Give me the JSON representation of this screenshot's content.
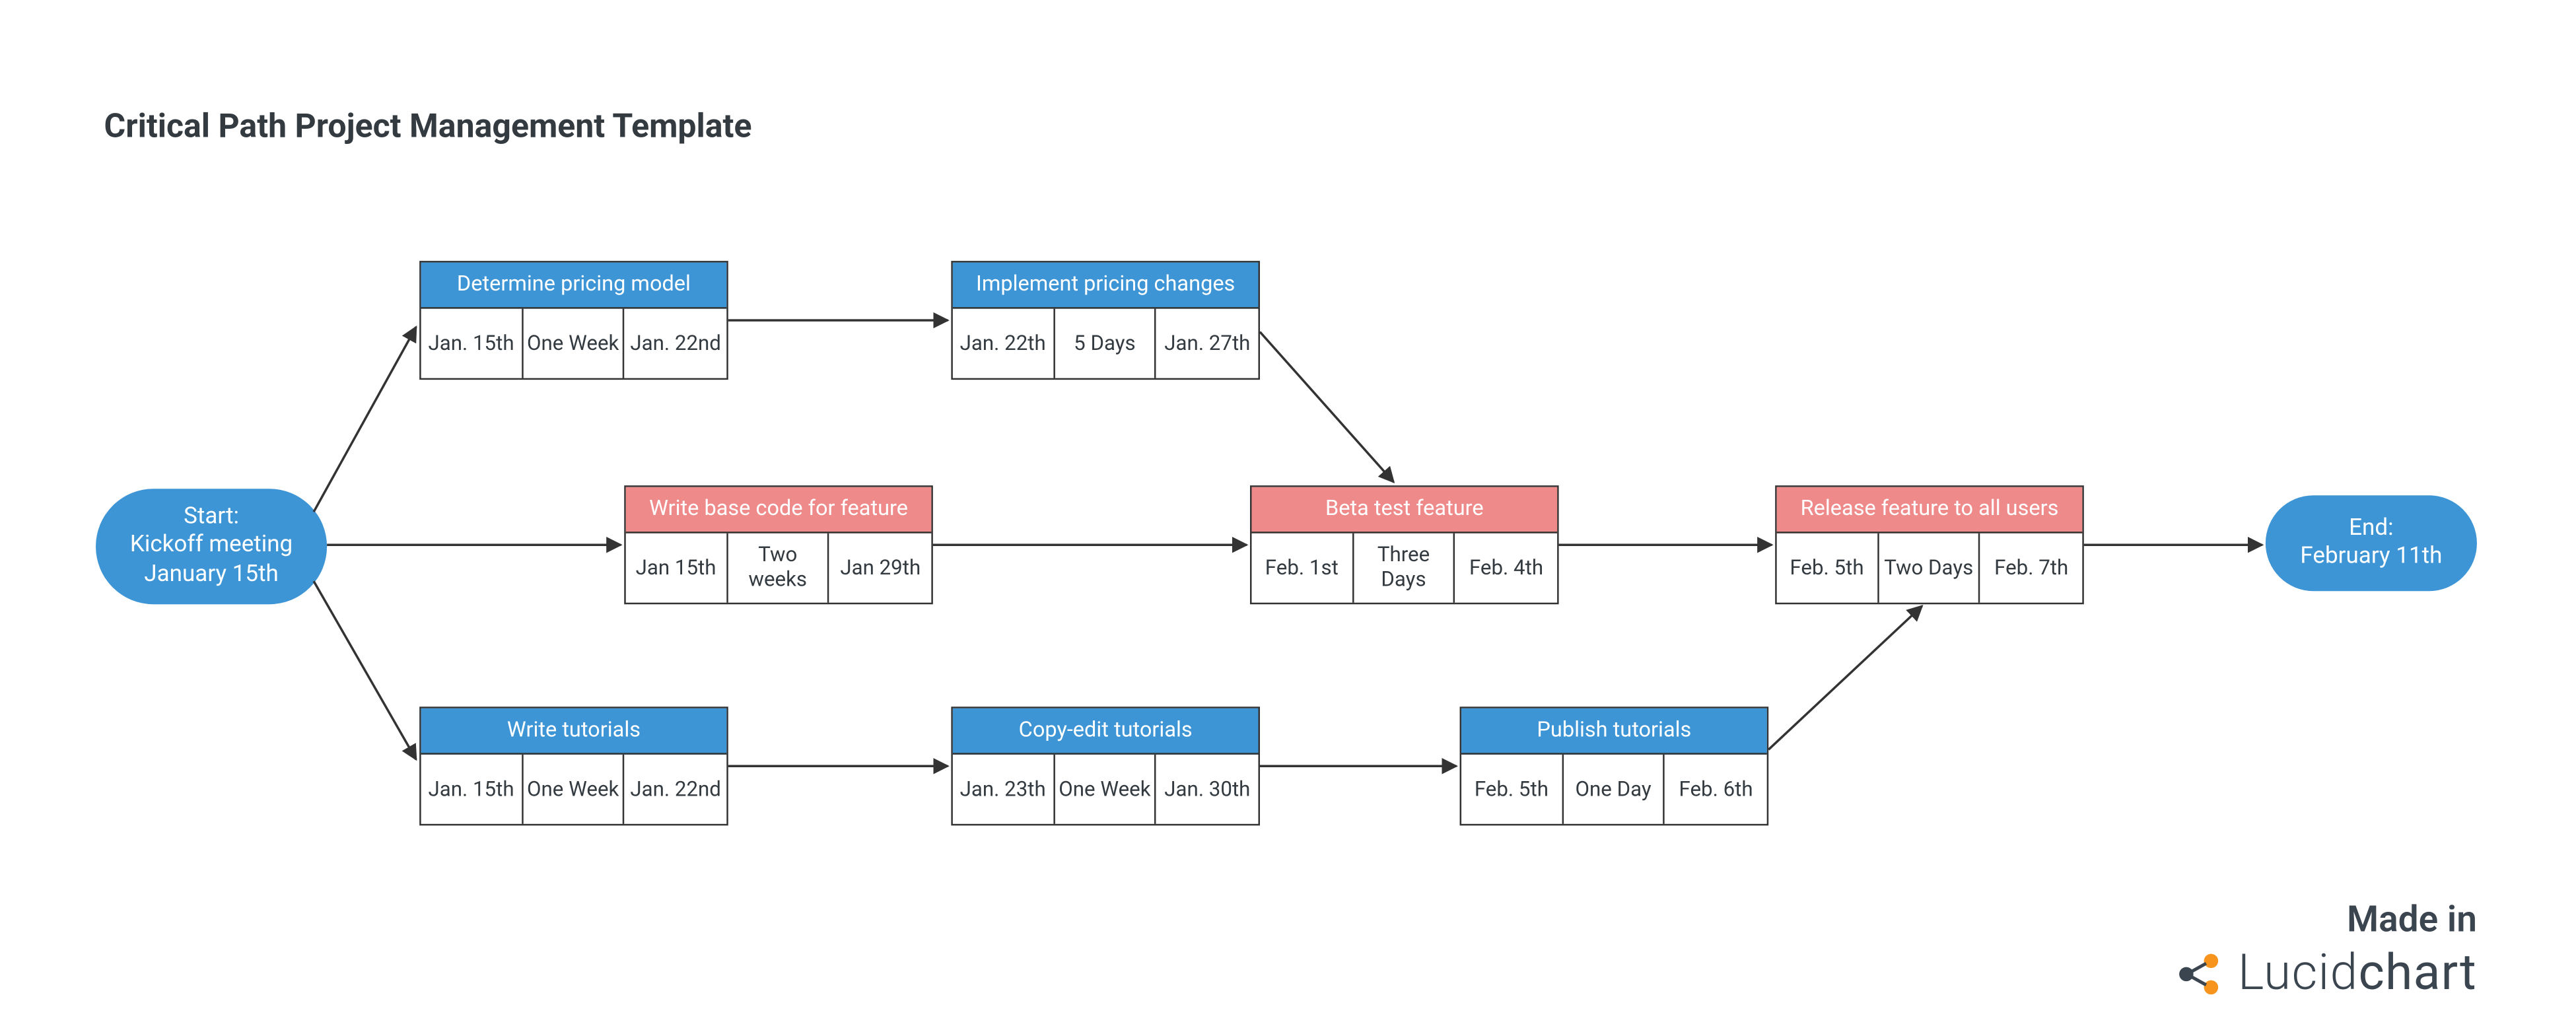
{
  "title": "Critical Path Project Management Template",
  "colors": {
    "blue": "#3d95d6",
    "red": "#ef8a8a",
    "text": "#333a40"
  },
  "start": {
    "line1": "Start:",
    "line2": "Kickoff meeting",
    "line3": "January 15th"
  },
  "end": {
    "line1": "End:",
    "line2": "February 11th"
  },
  "tasks": {
    "determine_pricing": {
      "label": "Determine pricing model",
      "start": "Jan. 15th",
      "duration": "One Week",
      "finish": "Jan. 22nd"
    },
    "implement_pricing": {
      "label": "Implement pricing changes",
      "start": "Jan. 22th",
      "duration": "5 Days",
      "finish": "Jan. 27th"
    },
    "write_base_code": {
      "label": "Write base code for feature",
      "start": "Jan 15th",
      "duration": "Two weeks",
      "finish": "Jan 29th"
    },
    "beta_test": {
      "label": "Beta test feature",
      "start": "Feb. 1st",
      "duration": "Three Days",
      "finish": "Feb. 4th"
    },
    "release_feature": {
      "label": "Release feature to all users",
      "start": "Feb. 5th",
      "duration": "Two Days",
      "finish": "Feb. 7th"
    },
    "write_tutorials": {
      "label": "Write tutorials",
      "start": "Jan. 15th",
      "duration": "One Week",
      "finish": "Jan. 22nd"
    },
    "copy_edit": {
      "label": "Copy-edit tutorials",
      "start": "Jan. 23th",
      "duration": "One Week",
      "finish": "Jan. 30th"
    },
    "publish_tutorials": {
      "label": "Publish tutorials",
      "start": "Feb. 5th",
      "duration": "One Day",
      "finish": "Feb. 6th"
    }
  },
  "brand": {
    "made": "Made in",
    "name_a": "Lucid",
    "name_b": "chart"
  },
  "chart_data": {
    "type": "table",
    "description": "CPM/PERT style critical-path diagram. Each task box shows start date, duration, end date. Red boxes are on the critical path.",
    "terminals": {
      "start": {
        "label": "Start: Kickoff meeting",
        "date": "January 15th"
      },
      "end": {
        "label": "End",
        "date": "February 11th"
      }
    },
    "nodes": [
      {
        "id": "determine_pricing",
        "label": "Determine pricing model",
        "start": "Jan. 15th",
        "duration": "One Week",
        "end": "Jan. 22nd",
        "critical": false
      },
      {
        "id": "implement_pricing",
        "label": "Implement pricing changes",
        "start": "Jan. 22th",
        "duration": "5 Days",
        "end": "Jan. 27th",
        "critical": false
      },
      {
        "id": "write_base_code",
        "label": "Write base code for feature",
        "start": "Jan 15th",
        "duration": "Two weeks",
        "end": "Jan 29th",
        "critical": true
      },
      {
        "id": "beta_test",
        "label": "Beta test feature",
        "start": "Feb. 1st",
        "duration": "Three Days",
        "end": "Feb. 4th",
        "critical": true
      },
      {
        "id": "release_feature",
        "label": "Release feature to all users",
        "start": "Feb. 5th",
        "duration": "Two Days",
        "end": "Feb. 7th",
        "critical": true
      },
      {
        "id": "write_tutorials",
        "label": "Write tutorials",
        "start": "Jan. 15th",
        "duration": "One Week",
        "end": "Jan. 22nd",
        "critical": false
      },
      {
        "id": "copy_edit",
        "label": "Copy-edit tutorials",
        "start": "Jan. 23th",
        "duration": "One Week",
        "end": "Jan. 30th",
        "critical": false
      },
      {
        "id": "publish_tutorials",
        "label": "Publish tutorials",
        "start": "Feb. 5th",
        "duration": "One Day",
        "end": "Feb. 6th",
        "critical": false
      }
    ],
    "edges": [
      [
        "start",
        "determine_pricing"
      ],
      [
        "start",
        "write_base_code"
      ],
      [
        "start",
        "write_tutorials"
      ],
      [
        "determine_pricing",
        "implement_pricing"
      ],
      [
        "implement_pricing",
        "beta_test"
      ],
      [
        "write_base_code",
        "beta_test"
      ],
      [
        "beta_test",
        "release_feature"
      ],
      [
        "release_feature",
        "end"
      ],
      [
        "write_tutorials",
        "copy_edit"
      ],
      [
        "copy_edit",
        "publish_tutorials"
      ],
      [
        "publish_tutorials",
        "release_feature"
      ]
    ]
  }
}
